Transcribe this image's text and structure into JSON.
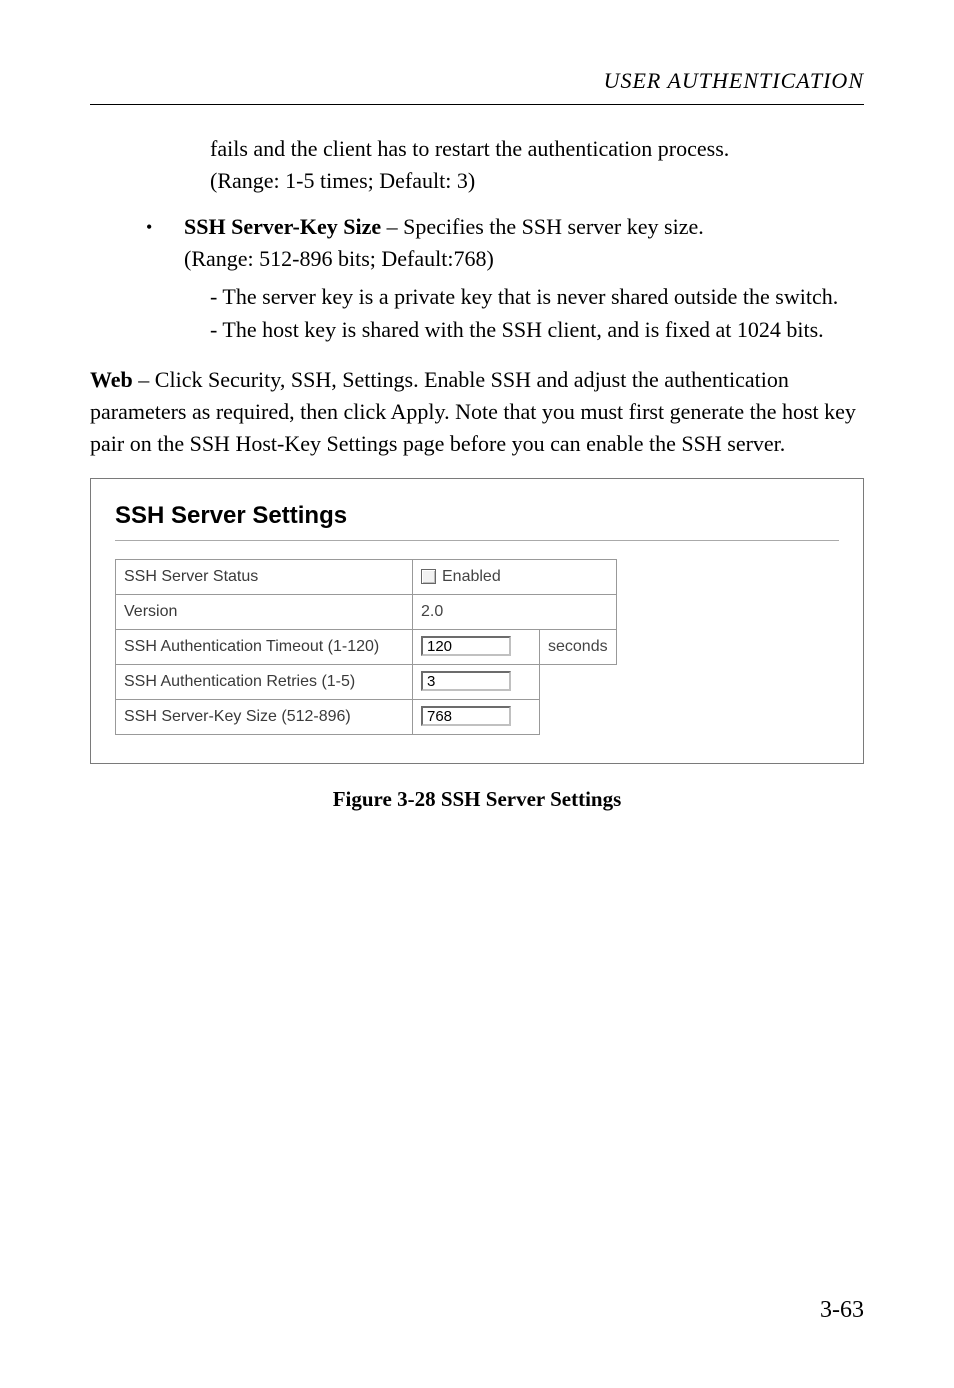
{
  "header": {
    "title": "USER AUTHENTICATION"
  },
  "text": {
    "para1_line1": "fails and the client has to restart the authentication process.",
    "para1_line2": "(Range: 1-5 times; Default: 3)",
    "bullet_label": "SSH Server-Key Size",
    "bullet_rest": " – Specifies the SSH server key size.",
    "bullet_line2": "(Range: 512-896 bits; Default:768)",
    "sub1": "-  The server key is a private key that is never shared outside the switch.",
    "sub2": "-  The host key is shared with the SSH client, and is fixed at 1024 bits.",
    "web_bold": "Web",
    "web_rest": " – Click Security, SSH, Settings. Enable SSH and adjust the authentication parameters as required, then click Apply. Note that you must first generate the host key pair on the SSH Host-Key Settings page before you can enable the SSH server."
  },
  "figure": {
    "title": "SSH Server Settings",
    "rows": {
      "r1_label": "SSH Server Status",
      "r1_enabled": "Enabled",
      "r2_label": "Version",
      "r2_value": "2.0",
      "r3_label": "SSH Authentication Timeout (1-120)",
      "r3_value": "120",
      "r3_unit": "seconds",
      "r4_label": "SSH Authentication Retries (1-5)",
      "r4_value": "3",
      "r5_label": "SSH Server-Key Size (512-896)",
      "r5_value": "768"
    },
    "caption": "Figure 3-28  SSH Server Settings"
  },
  "page_number": "3-63"
}
